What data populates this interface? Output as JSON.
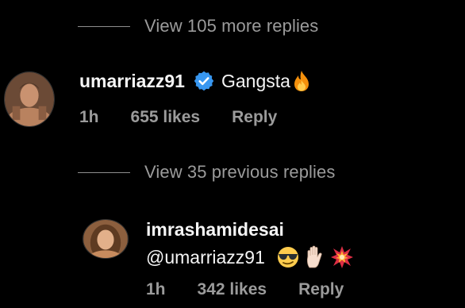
{
  "thread": {
    "view_more": "View 105 more replies",
    "view_previous": "View 35 previous replies"
  },
  "comment1": {
    "username": "umarriazz91",
    "verified": true,
    "text": "Gangsta",
    "emoji": [
      "fire-emoji"
    ],
    "time": "1h",
    "likes": "655 likes",
    "reply": "Reply"
  },
  "comment2": {
    "username": "imrashamidesai",
    "mention": "@umarriazz91",
    "emoji": [
      "sunglasses-emoji",
      "raised-hand-emoji",
      "collision-emoji"
    ],
    "time": "1h",
    "likes": "342 likes",
    "reply": "Reply"
  },
  "colors": {
    "background": "#000000",
    "primary_text": "#f5f5f5",
    "secondary_text": "#9b9b9b",
    "verified_blue": "#3897f0"
  }
}
